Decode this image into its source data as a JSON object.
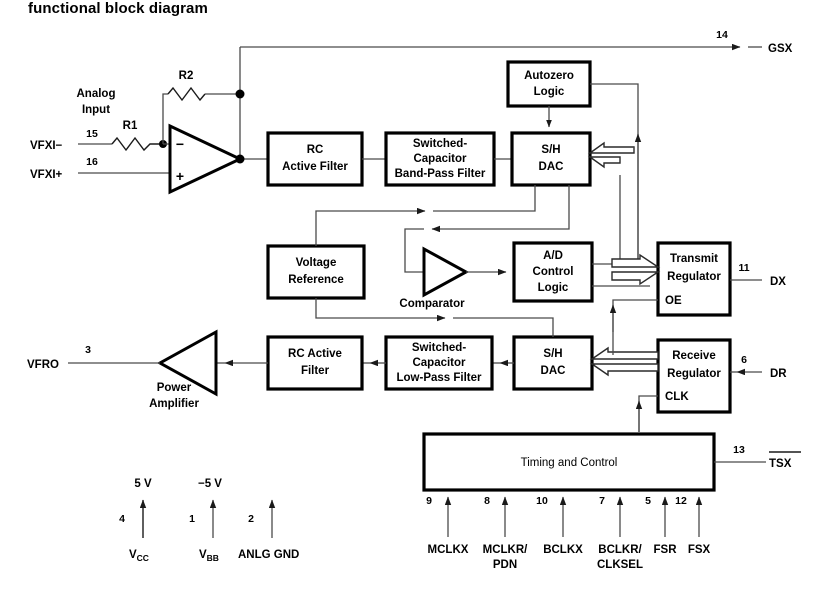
{
  "page": {
    "title": "functional block diagram"
  },
  "blocks": {
    "autozero": {
      "line1": "Autozero",
      "line2": "Logic"
    },
    "rc_active_filter_top": {
      "line1": "RC",
      "line2": "Active Filter"
    },
    "sc_bandpass": {
      "line1": "Switched-",
      "line2": "Capacitor",
      "line3": "Band-Pass Filter"
    },
    "sh_dac_top": {
      "line1": "S/H",
      "line2": "DAC"
    },
    "voltage_reference": {
      "line1": "Voltage",
      "line2": "Reference"
    },
    "ad_control_logic": {
      "line1": "A/D",
      "line2": "Control",
      "line3": "Logic"
    },
    "transmit_regulator": {
      "line1": "Transmit",
      "line2": "Regulator",
      "oe": "OE"
    },
    "receive_regulator": {
      "line1": "Receive",
      "line2": "Regulator",
      "clk": "CLK"
    },
    "rc_active_filter_bottom": {
      "line1": "RC Active",
      "line2": "Filter"
    },
    "sc_lowpass": {
      "line1": "Switched-",
      "line2": "Capacitor",
      "line3": "Low-Pass Filter"
    },
    "sh_dac_bottom": {
      "line1": "S/H",
      "line2": "DAC"
    },
    "timing_and_control": {
      "label": "Timing and Control"
    }
  },
  "amplifiers": {
    "input_opamp": {
      "minus": "−",
      "plus": "+"
    },
    "comparator": {
      "label": "Comparator"
    },
    "power_amplifier": {
      "line1": "Power",
      "line2": "Amplifier"
    }
  },
  "passives": {
    "r1": "R1",
    "r2": "R2",
    "analog_input": {
      "line1": "Analog",
      "line2": "Input"
    }
  },
  "pins": {
    "vfxi_minus": {
      "name": "VFXI−",
      "number": "15"
    },
    "vfxi_plus": {
      "name": "VFXI+",
      "number": "16"
    },
    "gsx": {
      "name": "GSX",
      "number": "14"
    },
    "dx": {
      "name": "DX",
      "number": "11"
    },
    "dr": {
      "name": "DR",
      "number": "6"
    },
    "vfro": {
      "name": "VFRO",
      "number": "3"
    },
    "tsx": {
      "name": "TSX",
      "number": "13",
      "overline": true
    },
    "mclkx": {
      "name": "MCLKX",
      "number": "9"
    },
    "mclkr_pdn": {
      "line1": "MCLKR/",
      "line2": "PDN",
      "number": "8"
    },
    "bclkx": {
      "name": "BCLKX",
      "number": "10"
    },
    "bclkr_clksel": {
      "line1": "BCLKR/",
      "line2": "CLKSEL",
      "number": "7"
    },
    "fsr": {
      "name": "FSR",
      "number": "5"
    },
    "fsx": {
      "name": "FSX",
      "number": "12"
    }
  },
  "power": {
    "vcc": {
      "name": "V",
      "sub": "CC",
      "number": "4",
      "voltage": "5 V"
    },
    "vbb": {
      "name": "V",
      "sub": "BB",
      "number": "1",
      "voltage": "−5 V"
    },
    "anlg_gnd": {
      "name": "ANLG GND",
      "number": "2",
      "voltage": ""
    }
  },
  "colors": {
    "wire": "#4a4a4a",
    "box_stroke": "#000000",
    "background": "#ffffff"
  }
}
